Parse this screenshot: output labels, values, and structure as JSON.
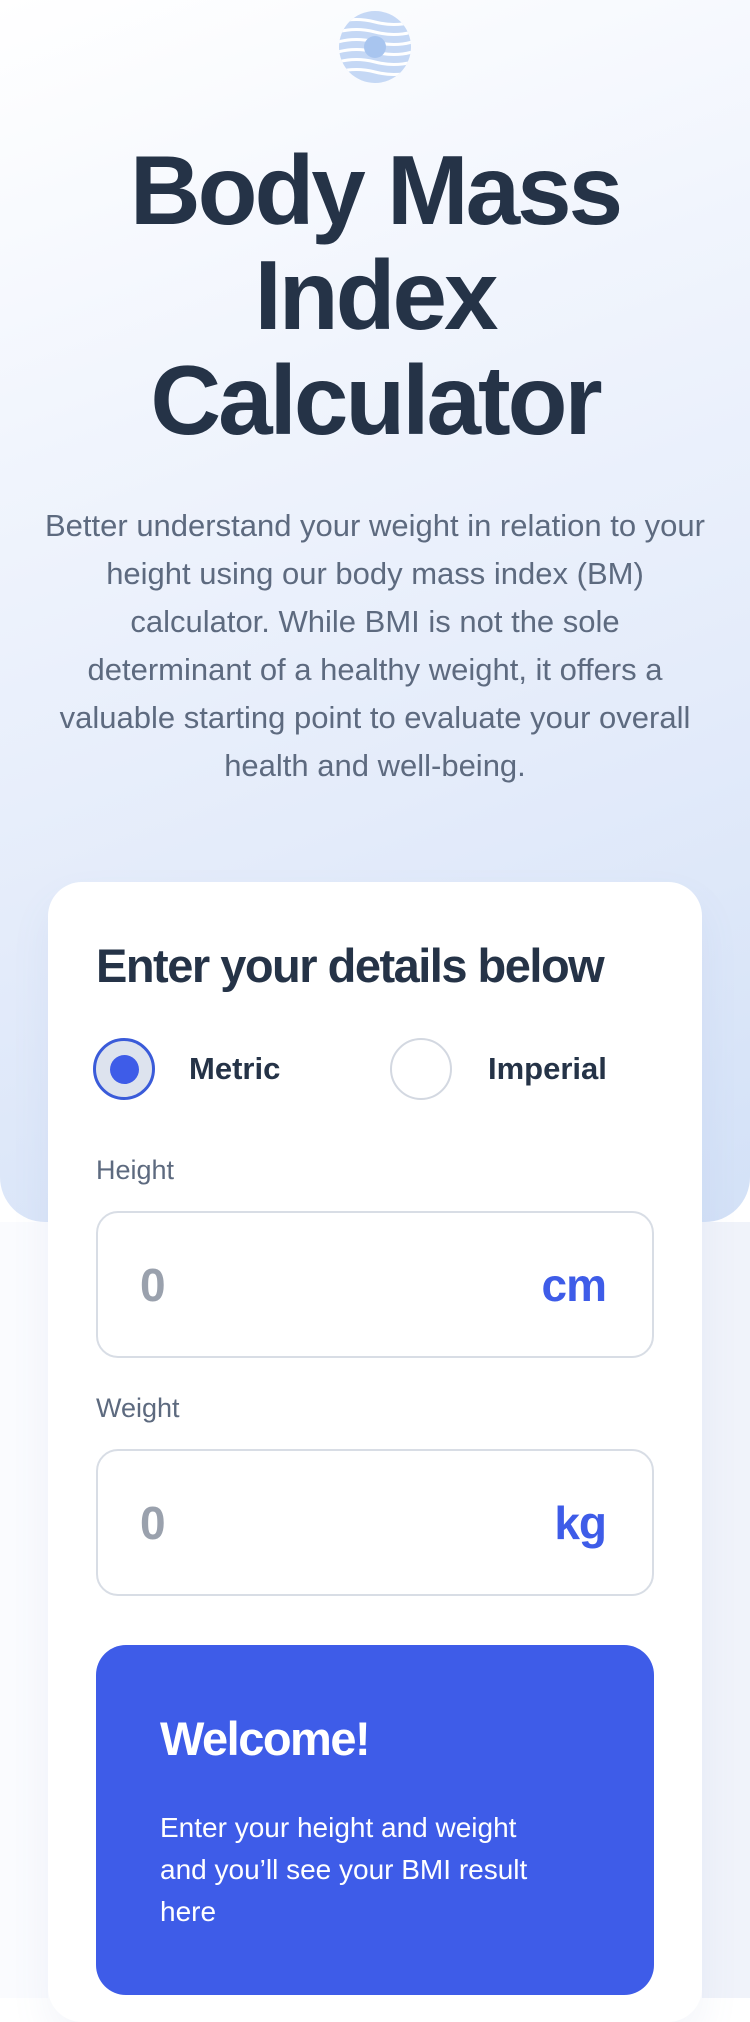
{
  "header": {
    "title": "Body Mass Index Calculator",
    "intro": "Better understand your weight in relation to your height using our body mass index (BM) calculator. While BMI is not the sole determinant of a healthy weight, it offers a valuable starting point to evaluate your overall health and well-being.",
    "logo_icon": "bmi-logo-icon"
  },
  "form": {
    "title": "Enter your details below",
    "units": {
      "selected": "metric",
      "metric_label": "Metric",
      "imperial_label": "Imperial"
    },
    "height": {
      "label": "Height",
      "value": "0",
      "unit": "cm"
    },
    "weight": {
      "label": "Weight",
      "value": "0",
      "unit": "kg"
    }
  },
  "result": {
    "title": "Welcome!",
    "message": "Enter your height and weight and you’ll see your BMI result here"
  },
  "colors": {
    "accent": "#3E5CE8",
    "heading": "#253347",
    "body_text": "#5D6A7F",
    "input_placeholder": "#9AA1AD",
    "hero_gradient_end": "#D3E1F7"
  }
}
